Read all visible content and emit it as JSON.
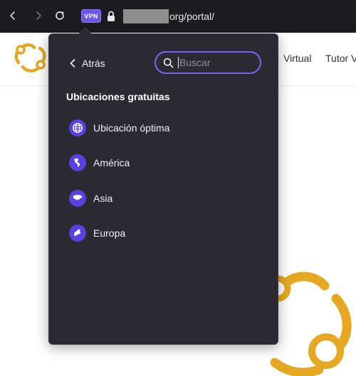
{
  "browser": {
    "url_suffix": "org/portal/",
    "vpn_badge": "VPN"
  },
  "page": {
    "nav_links": [
      "Virtual",
      "Tutor Vi"
    ]
  },
  "vpn_panel": {
    "back_label": "Atrás",
    "search_placeholder": "Buscar",
    "section_title": "Ubicaciones gratuitas",
    "locations": [
      {
        "label": "Ubicación óptima",
        "icon": "globe-icon"
      },
      {
        "label": "América",
        "icon": "americas-icon"
      },
      {
        "label": "Asia",
        "icon": "asia-icon"
      },
      {
        "label": "Europa",
        "icon": "europe-icon"
      }
    ]
  },
  "colors": {
    "toolbar_bg": "#1c1b22",
    "panel_bg": "#2b2a33",
    "accent": "#7a63f5",
    "icon_bg": "#5b3fe0",
    "logo_gold": "#e6a823"
  }
}
